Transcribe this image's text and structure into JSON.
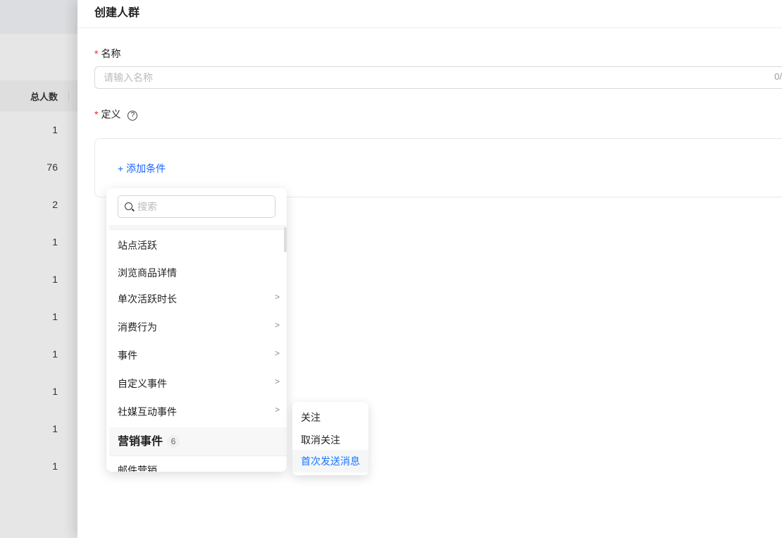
{
  "background": {
    "column_header": "总人数",
    "values": [
      "1",
      "76",
      "2",
      "1",
      "1",
      "1",
      "1",
      "1",
      "1",
      "1"
    ]
  },
  "drawer": {
    "title": "创建人群",
    "name_label": "名称",
    "name_placeholder": "请输入名称",
    "name_count": "0/",
    "definition_label": "定义",
    "help_icon": "?",
    "add_condition": "+ 添加条件"
  },
  "menu": {
    "search_placeholder": "搜索",
    "items": [
      {
        "label": "站点活跃",
        "chevron": ""
      },
      {
        "label": "浏览商品详情",
        "chevron": ""
      },
      {
        "label": "单次活跃时长",
        "chevron": ">"
      },
      {
        "label": "消费行为",
        "chevron": ">"
      },
      {
        "label": "事件",
        "chevron": ">"
      },
      {
        "label": "自定义事件",
        "chevron": ">"
      },
      {
        "label": "社媒互动事件",
        "chevron": ">"
      }
    ],
    "group": {
      "label": "营销事件",
      "count": "6"
    },
    "next_item": "邮件营销"
  },
  "submenu": {
    "items": [
      "关注",
      "取消关注",
      "首次发送消息"
    ],
    "active_color": "#1677ff"
  }
}
